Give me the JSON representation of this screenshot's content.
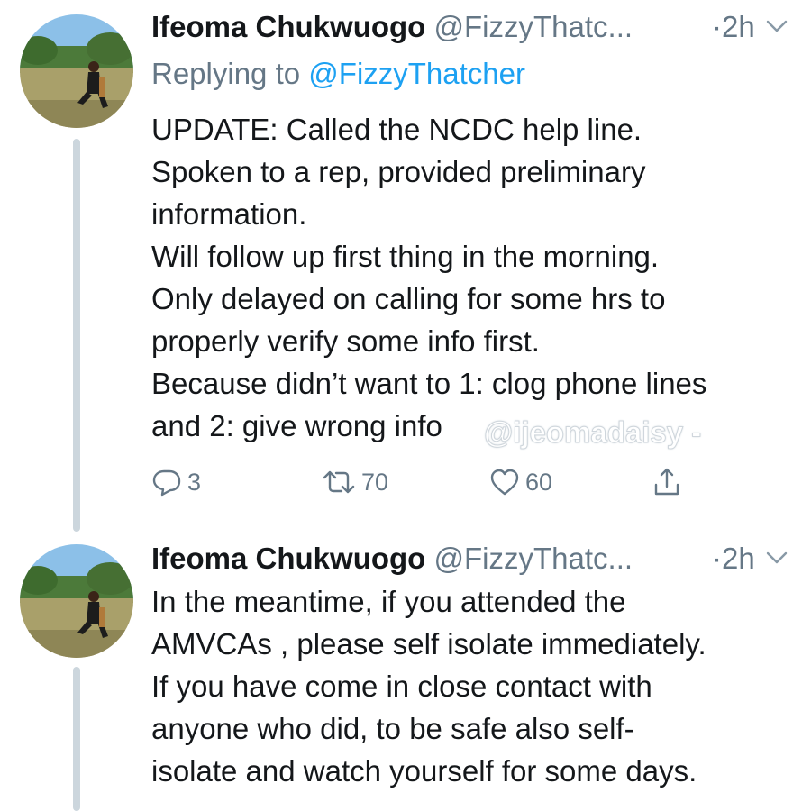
{
  "tweets": [
    {
      "name": "Ifeoma Chukwuogo",
      "handle": "@FizzyThatc...",
      "separator": "·",
      "time": "2h",
      "replying_prefix": "Replying to",
      "replying_handle": "@FizzyThatcher",
      "body_lines": [
        "UPDATE: Called the NCDC help line.",
        "Spoken to a rep, provided preliminary",
        "information.",
        "Will follow up first thing in the morning.",
        "Only delayed on calling for some hrs to",
        "properly verify some info first.",
        "Because didn’t want to 1: clog phone lines",
        "and 2: give wrong info"
      ],
      "watermark": "@ijeomadaisy -",
      "actions": {
        "reply_count": "3",
        "retweet_count": "70",
        "like_count": "60"
      },
      "icons": [
        "reply-icon",
        "retweet-icon",
        "like-icon",
        "share-icon",
        "chevron-down-icon"
      ]
    },
    {
      "name": "Ifeoma Chukwuogo",
      "handle": "@FizzyThatc...",
      "separator": "·",
      "time": "2h",
      "body_lines": [
        "In the meantime, if you attended the",
        "AMVCAs , please self isolate immediately.",
        "If you have come in close contact with",
        "anyone who did, to be safe also self-",
        "isolate and watch yourself for some days."
      ]
    }
  ],
  "colors": {
    "text": "#14171a",
    "secondary": "#657786",
    "link": "#1da1f2",
    "thread_line": "#ccd6dd"
  }
}
